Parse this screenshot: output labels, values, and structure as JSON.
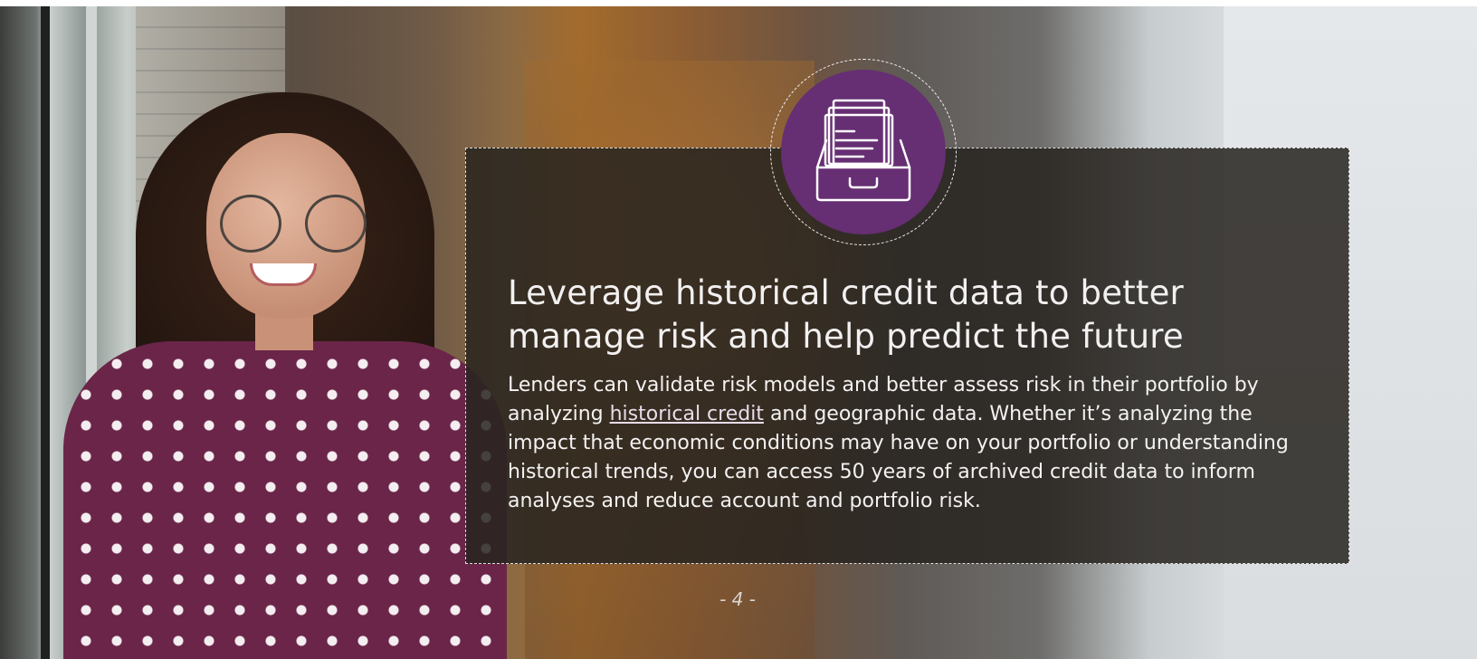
{
  "slide": {
    "headline": "Leverage historical credit data to better manage risk and help predict the future",
    "body_before_link": "Lenders can validate risk models and better assess risk in their portfolio by analyzing ",
    "link_text": "historical credit",
    "body_after_link": " and geographic data. Whether it’s analyzing the impact that economic conditions may have on your portfolio or understanding historical trends, you can access 50 years of archived credit data to inform analyses and reduce account and portfolio risk.",
    "page_number": "- 4 -",
    "icon": "archive-tray-icon"
  },
  "colors": {
    "accent_purple": "#662e73",
    "panel_overlay": "#282420",
    "text": "#f2f0f0"
  }
}
